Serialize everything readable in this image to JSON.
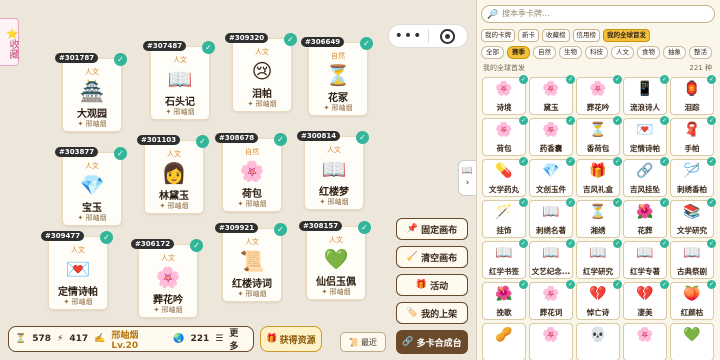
{
  "favorite_tab": {
    "label": "⭐收藏"
  },
  "capsule": {
    "more": "•••"
  },
  "canvas_cards": [
    {
      "id": "#301787",
      "category": "人文",
      "emoji": "🏯",
      "name": "大观园",
      "tag": "✦ 邢岫烟",
      "checked": true
    },
    {
      "id": "#307487",
      "category": "人文",
      "emoji": "📖",
      "name": "石头记",
      "tag": "✦ 邢岫烟",
      "checked": true
    },
    {
      "id": "#309320",
      "category": "人文",
      "emoji": "😢",
      "name": "泪帕",
      "tag": "✦ 邢岫烟",
      "checked": true
    },
    {
      "id": "#306649",
      "category": "自然",
      "emoji": "⏳",
      "name": "花冢",
      "tag": "✦ 邢岫烟",
      "checked": true
    },
    {
      "id": "#303877",
      "category": "人文",
      "emoji": "💎",
      "name": "宝玉",
      "tag": "✦ 邢岫烟",
      "checked": true
    },
    {
      "id": "#301103",
      "category": "人文",
      "emoji": "👩",
      "name": "林黛玉",
      "tag": "✦ 邢岫烟",
      "checked": true
    },
    {
      "id": "#308678",
      "category": "自然",
      "emoji": "🌸",
      "name": "荷包",
      "tag": "✦ 邢岫烟",
      "checked": true
    },
    {
      "id": "#300814",
      "category": "人文",
      "emoji": "📖",
      "name": "红楼梦",
      "tag": "✦ 邢岫烟",
      "checked": true
    },
    {
      "id": "#309477",
      "category": "人文",
      "emoji": "💌",
      "name": "定情诗帕",
      "tag": "✦ 邢岫烟",
      "checked": true
    },
    {
      "id": "#306172",
      "category": "人文",
      "emoji": "🌸",
      "name": "葬花吟",
      "tag": "✦ 邢岫烟",
      "checked": true
    },
    {
      "id": "#309921",
      "category": "人文",
      "emoji": "📜",
      "name": "红楼诗词",
      "tag": "✦ 邢岫烟",
      "checked": true
    },
    {
      "id": "#308157",
      "category": "人文",
      "emoji": "💚",
      "name": "仙侣玉佩",
      "tag": "✦ 邢岫烟",
      "checked": true
    }
  ],
  "side_buttons": [
    {
      "icon": "📌",
      "label": "固定画布"
    },
    {
      "icon": "🧹",
      "label": "清空画布"
    },
    {
      "icon": "🎁",
      "label": "活动"
    },
    {
      "icon": "🏷️",
      "label": "我的上架"
    },
    {
      "icon": "🔗",
      "label": "多卡合成台"
    }
  ],
  "bottom_bar": {
    "cards": "578",
    "energy": "417",
    "level": "邢岫烟 Lv.20",
    "globe": "221",
    "more": "更多"
  },
  "get_resources": "获得资源",
  "recent": "最近",
  "collapse_icon": "📖",
  "panel": {
    "search_placeholder": "搜本季卡牌...",
    "filters": [
      {
        "label": "我的卡牌",
        "on": false
      },
      {
        "label": "新卡",
        "on": false
      },
      {
        "label": "收藏榜",
        "on": false
      },
      {
        "label": "信用榜",
        "on": false
      },
      {
        "label": "我的全球首发",
        "on": true
      }
    ],
    "categories": [
      {
        "label": "全部",
        "on": false
      },
      {
        "label": "赛季",
        "on": true
      },
      {
        "label": "自然",
        "on": false
      },
      {
        "label": "生物",
        "on": false
      },
      {
        "label": "科技",
        "on": false
      },
      {
        "label": "人文",
        "on": false
      },
      {
        "label": "食物",
        "on": false
      },
      {
        "label": "抽象",
        "on": false
      },
      {
        "label": "整活",
        "on": false
      }
    ],
    "section_label": "我的全球首发",
    "count": "221 种",
    "grid": [
      [
        {
          "e": "🌸",
          "n": "诗境"
        },
        {
          "e": "🌸",
          "n": "黛玉"
        },
        {
          "e": "🌸",
          "n": "葬花吟"
        },
        {
          "e": "📱",
          "n": "流浪诗人"
        },
        {
          "e": "🏮",
          "n": "泪踪"
        }
      ],
      [
        {
          "e": "🌸",
          "n": "荷包"
        },
        {
          "e": "🌸",
          "n": "药香囊"
        },
        {
          "e": "⏳",
          "n": "香荷包"
        },
        {
          "e": "💌",
          "n": "定情诗帕"
        },
        {
          "e": "🧣",
          "n": "手帕"
        }
      ],
      [
        {
          "e": "💊",
          "n": "文学药丸"
        },
        {
          "e": "💎",
          "n": "文创玉件"
        },
        {
          "e": "🎁",
          "n": "吉风礼盒"
        },
        {
          "e": "🔗",
          "n": "吉风挂坠"
        },
        {
          "e": "🪡",
          "n": "刺绣香柏"
        }
      ],
      [
        {
          "e": "🪄",
          "n": "挂饰"
        },
        {
          "e": "📖",
          "n": "刺绣名著"
        },
        {
          "e": "⏳",
          "n": "湘绣"
        },
        {
          "e": "🌺",
          "n": "花葬"
        },
        {
          "e": "📚",
          "n": "文学研究"
        }
      ],
      [
        {
          "e": "📖",
          "n": "红学书签"
        },
        {
          "e": "📖",
          "n": "文艺纪念..."
        },
        {
          "e": "📖",
          "n": "红学研究"
        },
        {
          "e": "📖",
          "n": "红学专著"
        },
        {
          "e": "📖",
          "n": "古典祭剧"
        }
      ],
      [
        {
          "e": "🌺",
          "n": "挽歌"
        },
        {
          "e": "🌸",
          "n": "葬花词"
        },
        {
          "e": "💔",
          "n": "悼亡诗"
        },
        {
          "e": "💔",
          "n": "凄美"
        },
        {
          "e": "🍑",
          "n": "红颜枯"
        }
      ],
      [
        {
          "e": "🥜",
          "n": ""
        },
        {
          "e": "🌸",
          "n": ""
        },
        {
          "e": "💀",
          "n": ""
        },
        {
          "e": "🌸",
          "n": ""
        },
        {
          "e": "💚",
          "n": ""
        }
      ]
    ]
  }
}
